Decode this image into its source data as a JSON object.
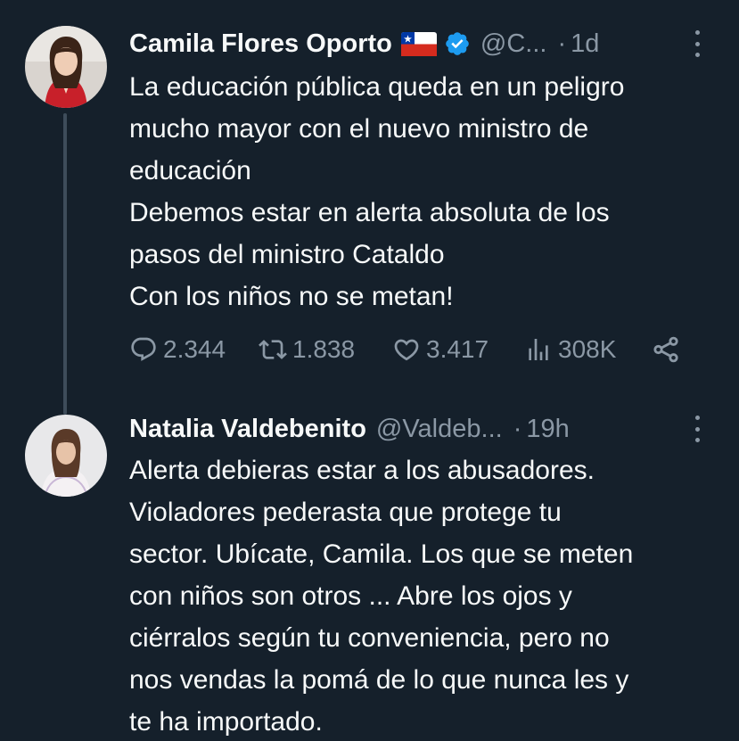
{
  "tweets": [
    {
      "name": "Camila Flores Oporto",
      "flag": "chile-flag",
      "verified": true,
      "handle": "@C...",
      "separator": "·",
      "time": "1d",
      "lines": [
        "La educación pública queda en un peligro",
        "mucho mayor con el nuevo ministro de",
        "educación",
        "Debemos estar en alerta absoluta de los",
        "pasos del ministro Cataldo",
        "Con los niños no se metan!"
      ],
      "stats": {
        "replies": "2.344",
        "retweets": "1.838",
        "likes": "3.417",
        "views": "308K"
      }
    },
    {
      "name": "Natalia Valdebenito",
      "handle": "@Valdeb...",
      "separator": "·",
      "time": "19h",
      "lines": [
        "Alerta debieras estar a los abusadores.",
        "Violadores pederasta que protege tu",
        "sector. Ubícate, Camila. Los que se meten",
        "con niños son otros ... Abre los ojos y",
        "ciérralos según tu conveniencia, pero no",
        "nos vendas la pomá de lo que nunca les y",
        "te ha importado."
      ]
    }
  ],
  "colors": {
    "background": "#15202b",
    "text": "#f7f9f9",
    "muted": "#8b98a5",
    "verified": "#1d9bf0",
    "thread_line": "#3e4c5a"
  }
}
